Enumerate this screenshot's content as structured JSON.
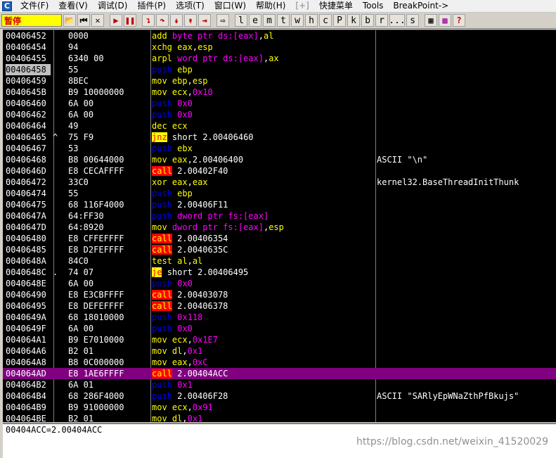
{
  "menubar": {
    "icon": "C",
    "items": [
      {
        "label": "文件(F)",
        "enabled": true
      },
      {
        "label": "查看(V)",
        "enabled": true
      },
      {
        "label": "调试(D)",
        "enabled": true
      },
      {
        "label": "插件(P)",
        "enabled": true
      },
      {
        "label": "选项(T)",
        "enabled": true
      },
      {
        "label": "窗口(W)",
        "enabled": true
      },
      {
        "label": "帮助(H)",
        "enabled": true
      },
      {
        "label": "[+]",
        "enabled": false
      },
      {
        "label": "快捷菜单",
        "enabled": true
      },
      {
        "label": "Tools",
        "enabled": true
      },
      {
        "label": "BreakPoint->",
        "enabled": true
      }
    ]
  },
  "toolbar": {
    "status": "暂停",
    "letter_buttons": [
      "l",
      "e",
      "m",
      "t",
      "w",
      "h",
      "c",
      "P",
      "k",
      "b",
      "r",
      "...",
      "s"
    ]
  },
  "disasm": {
    "rows": [
      {
        "addr": "00406452",
        "arrow": "",
        "hex": "0000",
        "mn": "add",
        "mc": "m-yel",
        "ops": [
          [
            "byte ptr ds:[eax]",
            "o-mag"
          ],
          [
            ",",
            "o-wht"
          ],
          [
            "al",
            "o-yel"
          ]
        ],
        "cmt": ""
      },
      {
        "addr": "00406454",
        "arrow": "",
        "hex": "94",
        "mn": "xchg",
        "mc": "m-yel",
        "ops": [
          [
            "eax",
            "o-yel"
          ],
          [
            ",",
            "o-wht"
          ],
          [
            "esp",
            "o-yel"
          ]
        ],
        "cmt": ""
      },
      {
        "addr": "00406455",
        "arrow": "",
        "hex": "6340 00",
        "mn": "arpl",
        "mc": "m-yel",
        "ops": [
          [
            "word ptr ds:[eax]",
            "o-mag"
          ],
          [
            ",",
            "o-wht"
          ],
          [
            "ax",
            "o-yel"
          ]
        ],
        "cmt": ""
      },
      {
        "addr": "00406458",
        "arrow": "",
        "hex": "55",
        "mn": "push",
        "mc": "m-blue",
        "ops": [
          [
            "ebp",
            "o-yel"
          ]
        ],
        "cmt": "",
        "hl": true
      },
      {
        "addr": "00406459",
        "arrow": "",
        "hex": "8BEC",
        "mn": "mov",
        "mc": "m-yel",
        "ops": [
          [
            "ebp",
            "o-yel"
          ],
          [
            ",",
            "o-wht"
          ],
          [
            "esp",
            "o-yel"
          ]
        ],
        "cmt": ""
      },
      {
        "addr": "0040645B",
        "arrow": "",
        "hex": "B9 10000000",
        "mn": "mov",
        "mc": "m-yel",
        "ops": [
          [
            "ecx",
            "o-yel"
          ],
          [
            ",",
            "o-wht"
          ],
          [
            "0x10",
            "o-mag"
          ]
        ],
        "cmt": ""
      },
      {
        "addr": "00406460",
        "arrow": "",
        "hex": "6A 00",
        "mn": "push",
        "mc": "m-blue",
        "ops": [
          [
            "0x0",
            "o-mag"
          ]
        ],
        "cmt": ""
      },
      {
        "addr": "00406462",
        "arrow": "",
        "hex": "6A 00",
        "mn": "push",
        "mc": "m-blue",
        "ops": [
          [
            "0x0",
            "o-mag"
          ]
        ],
        "cmt": ""
      },
      {
        "addr": "00406464",
        "arrow": "",
        "hex": "49",
        "mn": "dec",
        "mc": "m-yel",
        "ops": [
          [
            "ecx",
            "o-yel"
          ]
        ],
        "cmt": ""
      },
      {
        "addr": "00406465",
        "arrow": "^",
        "hex": "75 F9",
        "mn": "jnz",
        "mc": "m-jcc",
        "ops": [
          [
            "short 2.00406460",
            "o-wht"
          ]
        ],
        "cmt": ""
      },
      {
        "addr": "00406467",
        "arrow": "",
        "hex": "53",
        "mn": "push",
        "mc": "m-blue",
        "ops": [
          [
            "ebx",
            "o-yel"
          ]
        ],
        "cmt": ""
      },
      {
        "addr": "00406468",
        "arrow": "",
        "hex": "B8 00644000",
        "mn": "mov",
        "mc": "m-yel",
        "ops": [
          [
            "eax",
            "o-yel"
          ],
          [
            ",2.00406400",
            "o-wht"
          ]
        ],
        "cmt": "ASCII \"\\n\""
      },
      {
        "addr": "0040646D",
        "arrow": "",
        "hex": "E8 CECAFFFF",
        "mn": "call",
        "mc": "m-call",
        "ops": [
          [
            "2.00402F40",
            "o-wht"
          ]
        ],
        "cmt": ""
      },
      {
        "addr": "00406472",
        "arrow": "",
        "hex": "33C0",
        "mn": "xor",
        "mc": "m-yel",
        "ops": [
          [
            "eax",
            "o-yel"
          ],
          [
            ",",
            "o-wht"
          ],
          [
            "eax",
            "o-yel"
          ]
        ],
        "cmt": "kernel32.BaseThreadInitThunk"
      },
      {
        "addr": "00406474",
        "arrow": "",
        "hex": "55",
        "mn": "push",
        "mc": "m-blue",
        "ops": [
          [
            "ebp",
            "o-yel"
          ]
        ],
        "cmt": ""
      },
      {
        "addr": "00406475",
        "arrow": "",
        "hex": "68 116F4000",
        "mn": "push",
        "mc": "m-blue",
        "ops": [
          [
            "2.00406F11",
            "o-wht"
          ]
        ],
        "cmt": ""
      },
      {
        "addr": "0040647A",
        "arrow": "",
        "hex": "64:FF30",
        "mn": "push",
        "mc": "m-blue",
        "ops": [
          [
            "dword ptr fs:[eax]",
            "o-mag"
          ]
        ],
        "cmt": ""
      },
      {
        "addr": "0040647D",
        "arrow": "",
        "hex": "64:8920",
        "mn": "mov",
        "mc": "m-yel",
        "ops": [
          [
            "dword ptr fs:[eax]",
            "o-mag"
          ],
          [
            ",",
            "o-wht"
          ],
          [
            "esp",
            "o-yel"
          ]
        ],
        "cmt": ""
      },
      {
        "addr": "00406480",
        "arrow": "",
        "hex": "E8 CFFEFFFF",
        "mn": "call",
        "mc": "m-call",
        "ops": [
          [
            "2.00406354",
            "o-wht"
          ]
        ],
        "cmt": ""
      },
      {
        "addr": "00406485",
        "arrow": "",
        "hex": "E8 D2FEFFFF",
        "mn": "call",
        "mc": "m-call",
        "ops": [
          [
            "2.0040635C",
            "o-wht"
          ]
        ],
        "cmt": ""
      },
      {
        "addr": "0040648A",
        "arrow": "",
        "hex": "84C0",
        "mn": "test",
        "mc": "m-yel",
        "ops": [
          [
            "al",
            "o-yel"
          ],
          [
            ",",
            "o-wht"
          ],
          [
            "al",
            "o-yel"
          ]
        ],
        "cmt": ""
      },
      {
        "addr": "0040648C",
        "arrow": ".",
        "hex": "74 07",
        "mn": "je",
        "mc": "m-jcc",
        "ops": [
          [
            "short 2.00406495",
            "o-wht"
          ]
        ],
        "cmt": ""
      },
      {
        "addr": "0040648E",
        "arrow": "",
        "hex": "6A 00",
        "mn": "push",
        "mc": "m-blue",
        "ops": [
          [
            "0x0",
            "o-mag"
          ]
        ],
        "cmt": ""
      },
      {
        "addr": "00406490",
        "arrow": "",
        "hex": "E8 E3CBFFFF",
        "mn": "call",
        "mc": "m-call",
        "ops": [
          [
            "2.00403078",
            "o-wht"
          ]
        ],
        "cmt": ""
      },
      {
        "addr": "00406495",
        "arrow": "",
        "hex": "E8 DEFEFFFF",
        "mn": "call",
        "mc": "m-call",
        "ops": [
          [
            "2.00406378",
            "o-wht"
          ]
        ],
        "cmt": ""
      },
      {
        "addr": "0040649A",
        "arrow": "",
        "hex": "68 18010000",
        "mn": "push",
        "mc": "m-blue",
        "ops": [
          [
            "0x118",
            "o-mag"
          ]
        ],
        "cmt": ""
      },
      {
        "addr": "0040649F",
        "arrow": "",
        "hex": "6A 00",
        "mn": "push",
        "mc": "m-blue",
        "ops": [
          [
            "0x0",
            "o-mag"
          ]
        ],
        "cmt": ""
      },
      {
        "addr": "004064A1",
        "arrow": "",
        "hex": "B9 E7010000",
        "mn": "mov",
        "mc": "m-yel",
        "ops": [
          [
            "ecx",
            "o-yel"
          ],
          [
            ",",
            "o-wht"
          ],
          [
            "0x1E7",
            "o-mag"
          ]
        ],
        "cmt": ""
      },
      {
        "addr": "004064A6",
        "arrow": "",
        "hex": "B2 01",
        "mn": "mov",
        "mc": "m-yel",
        "ops": [
          [
            "dl",
            "o-yel"
          ],
          [
            ",",
            "o-wht"
          ],
          [
            "0x1",
            "o-mag"
          ]
        ],
        "cmt": ""
      },
      {
        "addr": "004064A8",
        "arrow": "",
        "hex": "B8 0C000000",
        "mn": "mov",
        "mc": "m-yel",
        "ops": [
          [
            "eax",
            "o-yel"
          ],
          [
            ",",
            "o-wht"
          ],
          [
            "0xC",
            "o-mag"
          ]
        ],
        "cmt": ""
      },
      {
        "addr": "004064AD",
        "arrow": "",
        "hex": "E8 1AE6FFFF",
        "mn": "call",
        "mc": "m-call",
        "ops": [
          [
            "2.00404ACC",
            "o-wht"
          ]
        ],
        "cmt": "",
        "sel": true
      },
      {
        "addr": "004064B2",
        "arrow": "",
        "hex": "6A 01",
        "mn": "push",
        "mc": "m-blue",
        "ops": [
          [
            "0x1",
            "o-mag"
          ]
        ],
        "cmt": ""
      },
      {
        "addr": "004064B4",
        "arrow": "",
        "hex": "68 286F4000",
        "mn": "push",
        "mc": "m-blue",
        "ops": [
          [
            "2.00406F28",
            "o-wht"
          ]
        ],
        "cmt": "ASCII \"SARlyEpWNaZthPfBkujs\""
      },
      {
        "addr": "004064B9",
        "arrow": "",
        "hex": "B9 91000000",
        "mn": "mov",
        "mc": "m-yel",
        "ops": [
          [
            "ecx",
            "o-yel"
          ],
          [
            ",",
            "o-wht"
          ],
          [
            "0x91",
            "o-mag"
          ]
        ],
        "cmt": ""
      },
      {
        "addr": "004064BE",
        "arrow": "",
        "hex": "B2 01",
        "mn": "mov",
        "mc": "m-yel",
        "ops": [
          [
            "dl",
            "o-yel"
          ],
          [
            ",",
            "o-wht"
          ],
          [
            "0x1",
            "o-mag"
          ]
        ],
        "cmt": ""
      }
    ]
  },
  "info": {
    "text": "00404ACC=2.00404ACC",
    "watermark": "https://blog.csdn.net/weixin_41520029"
  },
  "colors": {
    "disasm_bg": "#000000",
    "selected_row": "#800080",
    "call_bg": "#ff0000",
    "call_fg": "#ffff00",
    "jump_bg": "#ffff00",
    "jump_fg": "#ff0000",
    "push_fg": "#0000ff",
    "default_mnemonic": "#ffff00",
    "memory_operand": "#ff00ff",
    "status_bg": "#ffff00"
  }
}
